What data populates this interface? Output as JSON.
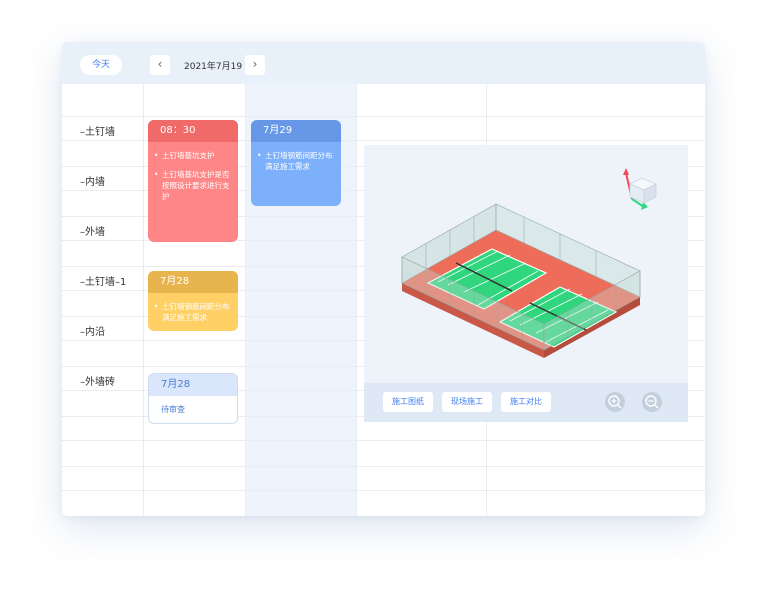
{
  "toolbar": {
    "today_label": "今天",
    "prev_icon": "‹",
    "next_icon": "›",
    "date": "2021年7月19"
  },
  "rows": [
    {
      "label": "–土钉墙"
    },
    {
      "label": "–内墙"
    },
    {
      "label": "–外墙"
    },
    {
      "label": "–土钉墙–1"
    },
    {
      "label": "–内沿"
    },
    {
      "label": "–外墙砖"
    }
  ],
  "cards": {
    "red": {
      "head": "08：30",
      "items": [
        "土钉墙基坑支护",
        "土钉墙基坑支护是否按照设计要求进行支护"
      ]
    },
    "blue": {
      "head": "7月29",
      "items": [
        "土钉墙钢筋间距分布满足施工需求"
      ]
    },
    "yellow": {
      "head": "7月28",
      "items": [
        "土钉墙钢筋间距分布满足施工需求"
      ]
    },
    "white": {
      "head": "7月28",
      "status": "待审查"
    }
  },
  "viewer": {
    "buttons": [
      "施工图纸",
      "现场施工",
      "施工对比"
    ],
    "zoom_in_icon": "zoom-in-icon",
    "zoom_out_icon": "zoom-out-icon"
  },
  "colors": {
    "accent": "#3d7ff0",
    "red": "#ff8686",
    "blue": "#7db0fb",
    "yellow": "#ffd066",
    "court": "#2fd67e",
    "court_surround": "#ee6d5a"
  }
}
